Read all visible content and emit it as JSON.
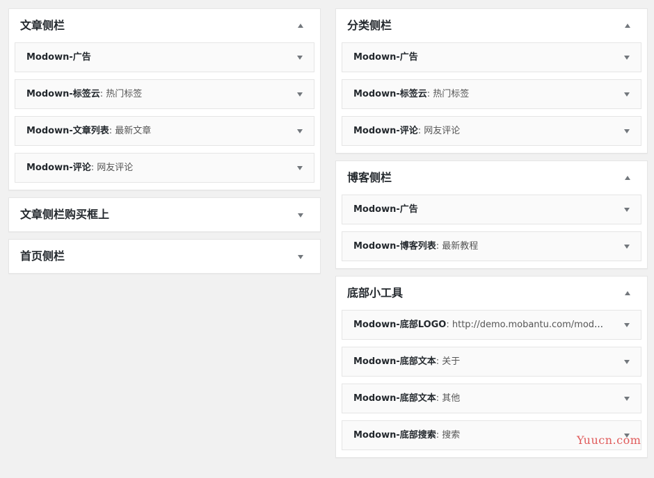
{
  "left_column": {
    "panels": [
      {
        "title": "文章侧栏",
        "expanded": true,
        "widgets": [
          {
            "name": "Modown-广告",
            "desc": ""
          },
          {
            "name": "Modown-标签云",
            "desc": ": 热门标签"
          },
          {
            "name": "Modown-文章列表",
            "desc": ": 最新文章"
          },
          {
            "name": "Modown-评论",
            "desc": ": 网友评论"
          }
        ]
      },
      {
        "title": "文章侧栏购买框上",
        "expanded": false,
        "widgets": []
      },
      {
        "title": "首页侧栏",
        "expanded": false,
        "widgets": []
      }
    ]
  },
  "right_column": {
    "panels": [
      {
        "title": "分类侧栏",
        "expanded": true,
        "widgets": [
          {
            "name": "Modown-广告",
            "desc": ""
          },
          {
            "name": "Modown-标签云",
            "desc": ": 热门标签"
          },
          {
            "name": "Modown-评论",
            "desc": ": 网友评论"
          }
        ]
      },
      {
        "title": "博客侧栏",
        "expanded": true,
        "widgets": [
          {
            "name": "Modown-广告",
            "desc": ""
          },
          {
            "name": "Modown-博客列表",
            "desc": ": 最新教程"
          }
        ]
      },
      {
        "title": "底部小工具",
        "expanded": true,
        "widgets": [
          {
            "name": "Modown-底部LOGO",
            "desc": ": http://demo.mobantu.com/modown/wp-content/themes/modown/static/img/logo.png"
          },
          {
            "name": "Modown-底部文本",
            "desc": ": 关于"
          },
          {
            "name": "Modown-底部文本",
            "desc": ": 其他"
          },
          {
            "name": "Modown-底部搜索",
            "desc": ": 搜索"
          }
        ]
      }
    ]
  },
  "watermark": "Yuucn.com",
  "colors": {
    "background": "#f1f1f1",
    "panel": "#ffffff",
    "widget": "#fafafa",
    "arrow": "#72777c",
    "watermark": "#e05a5a"
  },
  "icons": {
    "expanded": "triangle-up-icon",
    "collapsed": "triangle-down-icon",
    "widget": "triangle-down-icon"
  }
}
